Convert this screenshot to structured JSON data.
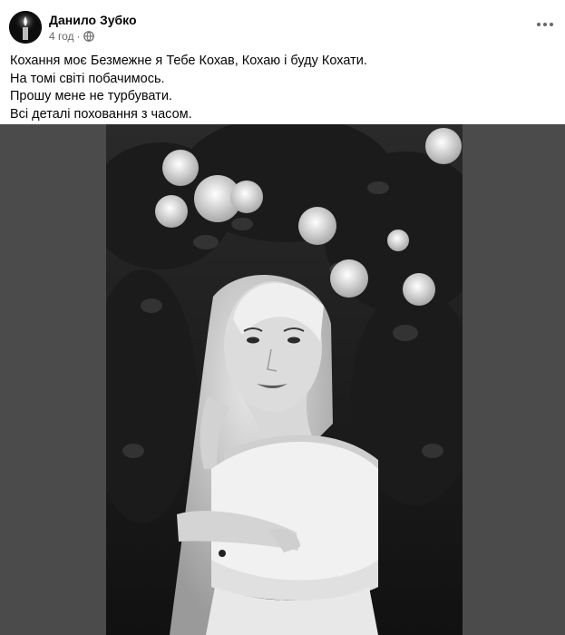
{
  "post": {
    "author_name": "Данило Зубко",
    "timestamp": "4 год",
    "separator": "·",
    "privacy_icon": "globe-icon",
    "more_icon": "more-options-icon",
    "text_lines": [
      "Кохання моє Безмежне я Тебе Кохав, Кохаю і буду Кохати.",
      "На томі світі побачимось.",
      "Прошу мене не турбувати.",
      "Всі деталі поховання з часом."
    ]
  },
  "colors": {
    "text_primary": "#050505",
    "text_secondary": "#65676b",
    "media_background": "#4b4b4b"
  },
  "media": {
    "type": "photo",
    "style": "black-and-white",
    "subject_icon": "woman-portrait-with-roses"
  }
}
